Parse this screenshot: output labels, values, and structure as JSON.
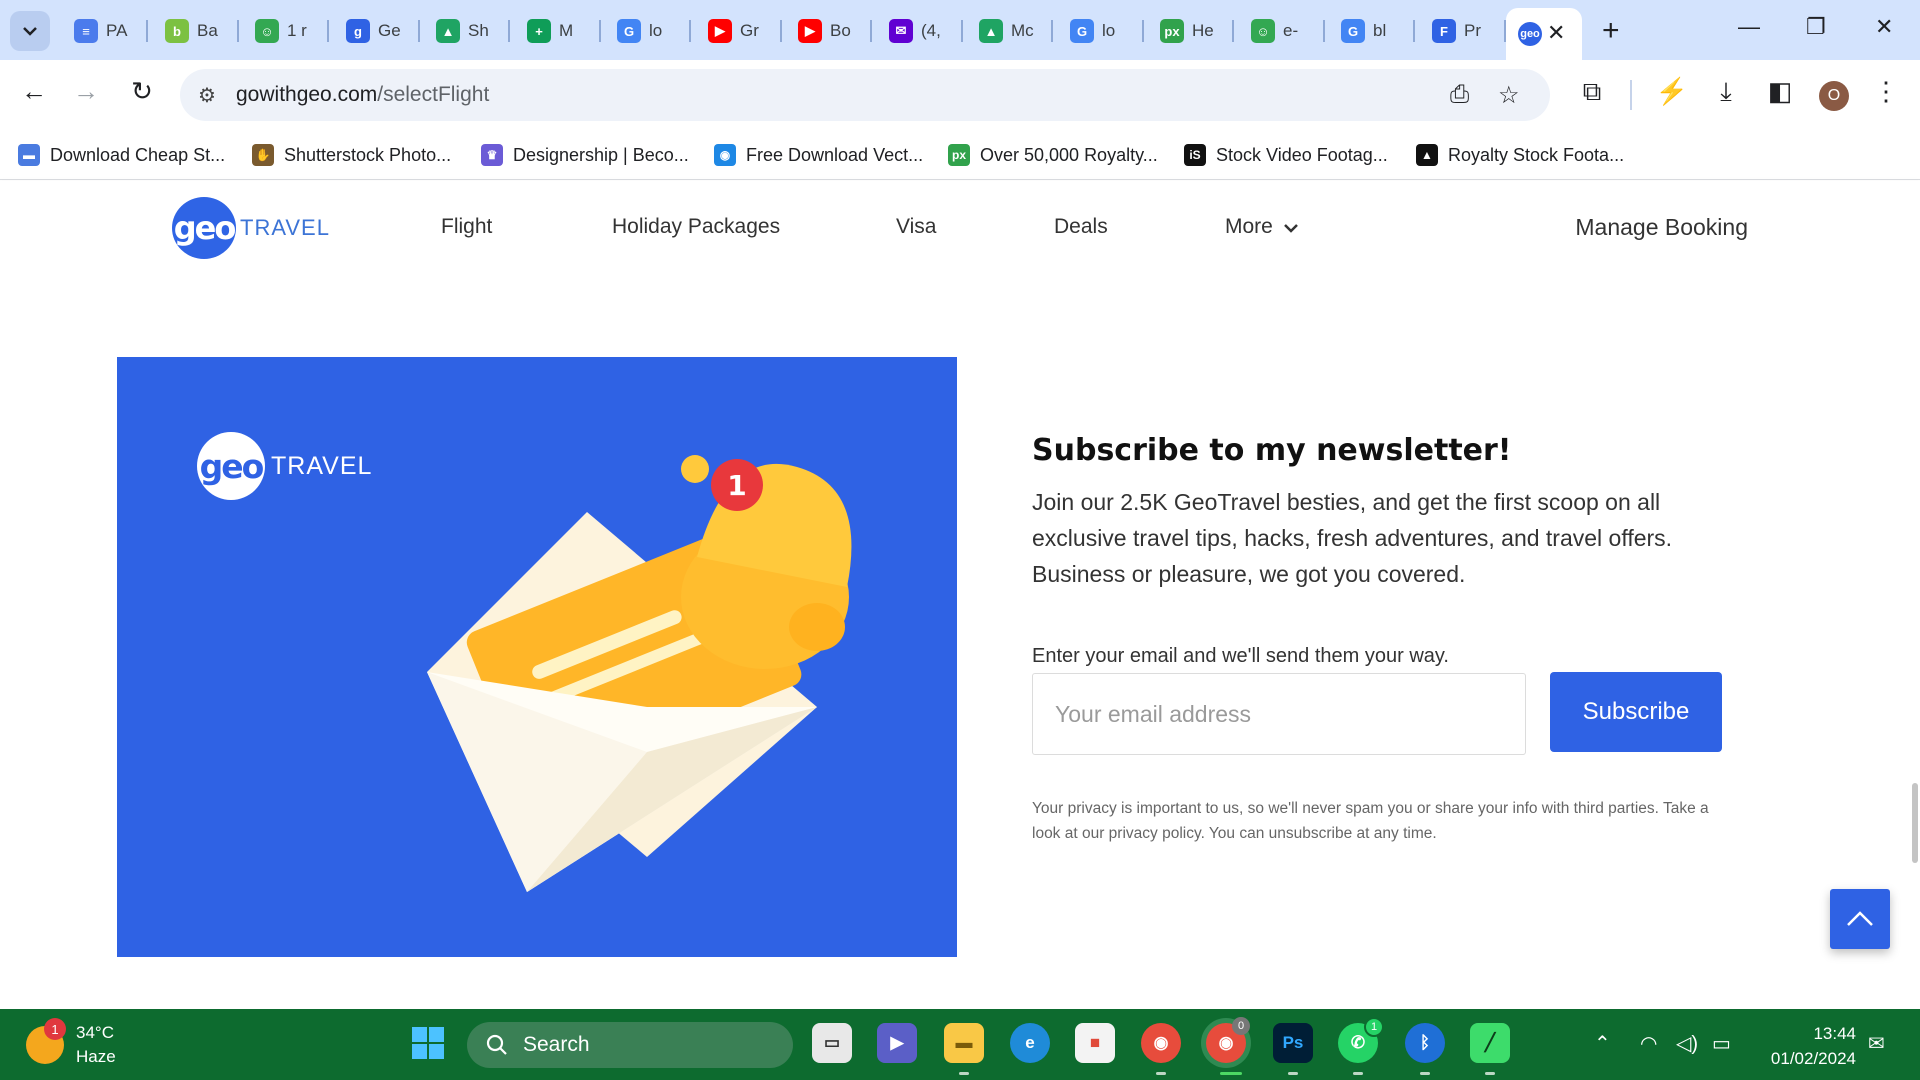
{
  "browser": {
    "tabs": [
      {
        "title": "PA",
        "color": "#4b7bec",
        "glyph": "≡"
      },
      {
        "title": "Ba",
        "color": "#7cc142",
        "glyph": "b"
      },
      {
        "title": "1 r",
        "color": "#33a852",
        "glyph": "☺"
      },
      {
        "title": "Ge",
        "color": "#2f62e4",
        "glyph": "g"
      },
      {
        "title": "Sh",
        "color": "#1fa463",
        "glyph": "▲"
      },
      {
        "title": "M",
        "color": "#0f9d58",
        "glyph": "+"
      },
      {
        "title": "lo",
        "color": "#4285f4",
        "glyph": "G"
      },
      {
        "title": "Gr",
        "color": "#ff0000",
        "glyph": "▶"
      },
      {
        "title": "Bo",
        "color": "#ff0000",
        "glyph": "▶"
      },
      {
        "title": "(4,",
        "color": "#6001d2",
        "glyph": "✉"
      },
      {
        "title": "Mc",
        "color": "#1fa463",
        "glyph": "▲"
      },
      {
        "title": "lo",
        "color": "#4285f4",
        "glyph": "G"
      },
      {
        "title": "He",
        "color": "#31a24c",
        "glyph": "px"
      },
      {
        "title": "e-",
        "color": "#33a852",
        "glyph": "☺"
      },
      {
        "title": "bl",
        "color": "#4285f4",
        "glyph": "G"
      },
      {
        "title": "Pr",
        "color": "#2f62e4",
        "glyph": "F"
      }
    ],
    "active_tab_icon": "geo-icon",
    "url_domain": "gowithgeo.com",
    "url_path": "/selectFlight",
    "profile_initial": "O",
    "bookmarks": [
      {
        "label": "Download Cheap St...",
        "color": "#4a7be0",
        "glyph": "▬"
      },
      {
        "label": "Shutterstock Photo...",
        "color": "#7a5a2e",
        "glyph": "✋"
      },
      {
        "label": "Designership | Beco...",
        "color": "#6b5bd6",
        "glyph": "♛"
      },
      {
        "label": "Free Download Vect...",
        "color": "#1e88e5",
        "glyph": "◉"
      },
      {
        "label": "Over 50,000 Royalty...",
        "color": "#31a24c",
        "glyph": "px"
      },
      {
        "label": "Stock Video Footag...",
        "color": "#111111",
        "glyph": "iS"
      },
      {
        "label": "Royalty Stock Foota...",
        "color": "#111111",
        "glyph": "▲"
      }
    ]
  },
  "site": {
    "logo_text": "TRAVEL",
    "logo_mark": "geo",
    "nav": {
      "flight": "Flight",
      "holiday": "Holiday Packages",
      "visa": "Visa",
      "deals": "Deals",
      "more": "More",
      "manage": "Manage Booking"
    },
    "promo": {
      "logo_mark": "geo",
      "logo_text": "TRAVEL",
      "badge": "1"
    },
    "newsletter": {
      "title": "Subscribe to my newsletter!",
      "description": "Join our 2.5K GeoTravel besties, and get the first scoop on all exclusive travel tips, hacks, fresh adventures, and travel offers. Business or pleasure, we got you covered.",
      "email_label": "Enter your email and we'll send them your way.",
      "email_placeholder": "Your email address",
      "email_value": "",
      "button": "Subscribe",
      "privacy": "Your privacy is important to us, so we'll never spam you or share your info with third parties. Take a look at our privacy policy. You can unsubscribe at any time."
    },
    "colors": {
      "brand": "#2f62e4"
    }
  },
  "taskbar": {
    "weather_temp": "34°C",
    "weather_cond": "Haze",
    "weather_badge": "1",
    "search_label": "Search",
    "whatsapp_badge": "1",
    "chrome_badge": "0",
    "time": "13:44",
    "date": "01/02/2024"
  }
}
